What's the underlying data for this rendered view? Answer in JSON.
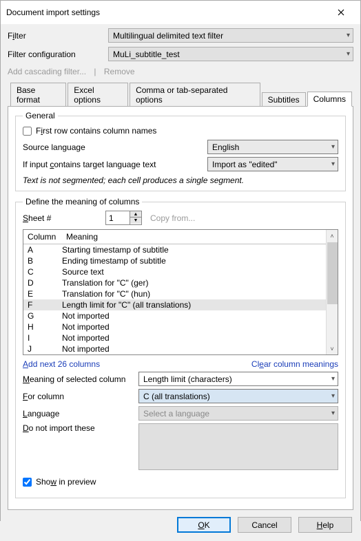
{
  "title": "Document import settings",
  "filter": {
    "label_pre": "F",
    "label_u": "i",
    "label_post": "lter",
    "value": "Multilingual delimited text filter"
  },
  "filter_config": {
    "label": "Filter configuration",
    "value": "MuLi_subtitle_test"
  },
  "linkrow": {
    "add": "Add cascading filter...",
    "remove": "Remove"
  },
  "tabs": [
    "Base format",
    "Excel options",
    "Comma or tab-separated options",
    "Subtitles",
    "Columns"
  ],
  "active_tab": 4,
  "general": {
    "legend": "General",
    "first_row_pre": "F",
    "first_row_u": "i",
    "first_row_post": "rst row contains column names",
    "first_row_checked": false,
    "source_lang_label": "Source language",
    "source_lang_value": "English",
    "if_input_pre": "If input ",
    "if_input_u": "c",
    "if_input_post": "ontains target language text",
    "if_input_value": "Import as \"edited\"",
    "note": "Text is not segmented; each cell produces a single segment."
  },
  "define": {
    "legend": "Define the meaning of columns",
    "sheet_pre": "",
    "sheet_u": "S",
    "sheet_post": "heet #",
    "sheet_value": "1",
    "copy_from": "Copy from...",
    "headers": {
      "col": "Column",
      "meaning": "Meaning"
    },
    "rows": [
      {
        "c": "A",
        "m": "Starting timestamp of subtitle"
      },
      {
        "c": "B",
        "m": "Ending timestamp of subtitle"
      },
      {
        "c": "C",
        "m": "Source text"
      },
      {
        "c": "D",
        "m": "Translation for \"C\" (ger)"
      },
      {
        "c": "E",
        "m": "Translation for \"C\" (hun)"
      },
      {
        "c": "F",
        "m": "Length limit for \"C\" (all translations)"
      },
      {
        "c": "G",
        "m": "Not imported"
      },
      {
        "c": "H",
        "m": "Not imported"
      },
      {
        "c": "I",
        "m": "Not imported"
      },
      {
        "c": "J",
        "m": "Not imported"
      }
    ],
    "selected_row": 5,
    "add_next_pre": "",
    "add_next_u": "A",
    "add_next_post": "dd next 26 columns",
    "clear_pre": "Cl",
    "clear_u": "e",
    "clear_post": "ar column meanings",
    "meaning_sel_pre": "",
    "meaning_sel_u": "M",
    "meaning_sel_post": "eaning of selected column",
    "meaning_sel_value": "Length limit (characters)",
    "for_col_pre": "",
    "for_col_u": "F",
    "for_col_post": "or column",
    "for_col_value": "C (all translations)",
    "language_pre": "",
    "language_u": "L",
    "language_post": "anguage",
    "language_value": "Select a language",
    "dni_pre": "",
    "dni_u": "D",
    "dni_post": "o not import these",
    "show_prev_pre": "Sho",
    "show_prev_u": "w",
    "show_prev_post": " in preview",
    "show_prev_checked": true
  },
  "buttons": {
    "ok_u": "O",
    "ok_post": "K",
    "cancel": "Cancel",
    "help_u": "H",
    "help_post": "elp"
  }
}
